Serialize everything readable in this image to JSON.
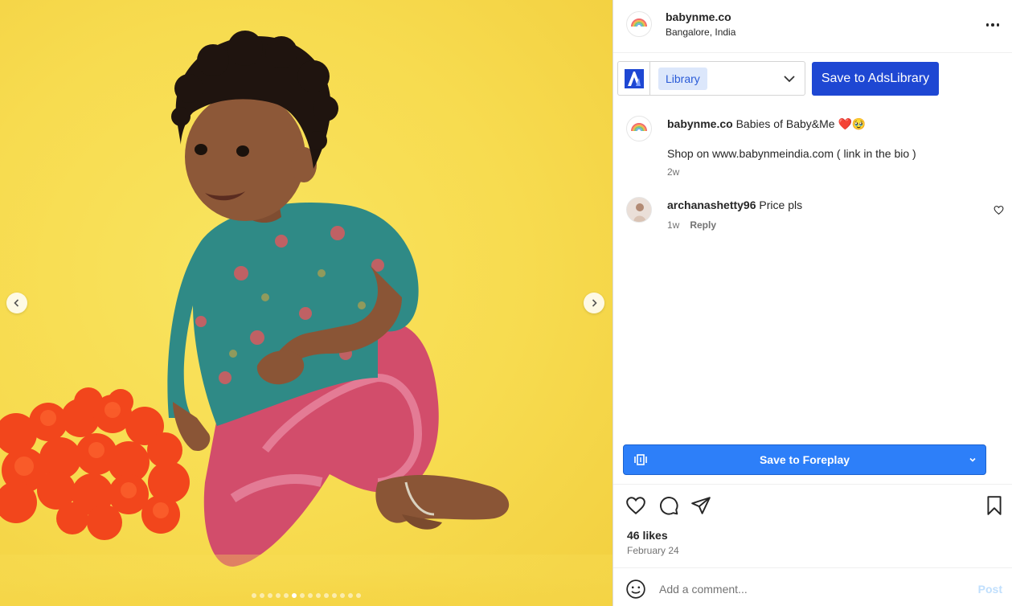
{
  "header": {
    "username": "babynme.co",
    "location": "Bangalore, India"
  },
  "toolbar": {
    "library_chip": "Library",
    "save_button": "Save to AdsLibrary"
  },
  "caption": {
    "username": "babynme.co",
    "text": "Babies of Baby&Me ❤️🥹",
    "body": "Shop on www.babynmeindia.com ( link in the bio )",
    "time": "2w"
  },
  "comments": [
    {
      "username": "archanashetty96",
      "text": "Price pls",
      "time": "1w",
      "reply": "Reply"
    }
  ],
  "foreplay": {
    "label": "Save to Foreplay"
  },
  "stats": {
    "likes": "46 likes",
    "date": "February 24"
  },
  "comment_box": {
    "placeholder": "Add a comment...",
    "post_label": "Post"
  },
  "carousel": {
    "count": 14,
    "active_index": 5
  },
  "colors": {
    "ads_blue": "#1e47d3",
    "foreplay_blue": "#2d7ff9",
    "background_yellow": "#f7db4f"
  }
}
